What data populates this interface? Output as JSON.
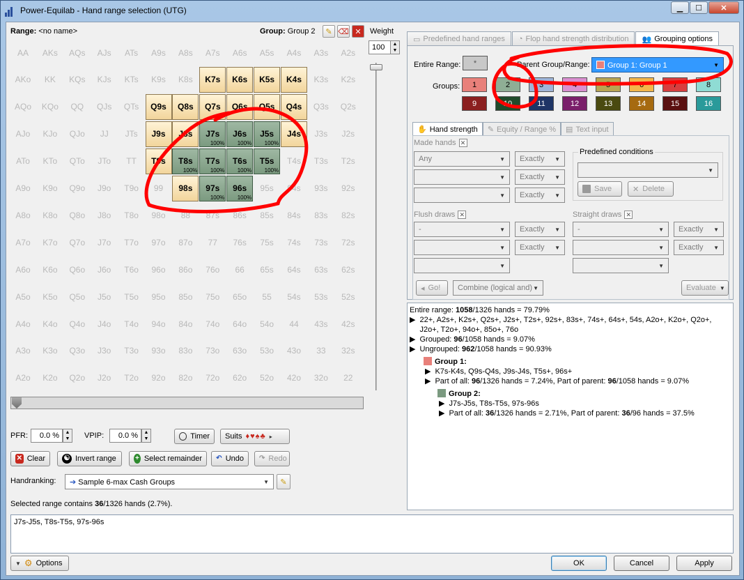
{
  "window": {
    "title": "Power-Equilab - Hand range selection (UTG)"
  },
  "header": {
    "range_label": "Range:",
    "range_value": "<no name>",
    "group_label": "Group:",
    "group_value": "Group 2",
    "weight_label": "Weight",
    "weight_value": "100"
  },
  "grid": {
    "ranks": [
      "A",
      "K",
      "Q",
      "J",
      "T",
      "9",
      "8",
      "7",
      "6",
      "5",
      "4",
      "3",
      "2"
    ],
    "group1": [
      "K7s",
      "K6s",
      "K5s",
      "K4s",
      "Q9s",
      "Q8s",
      "Q7s",
      "Q6s",
      "Q5s",
      "Q4s",
      "J9s",
      "J8s",
      "J4s",
      "T9s",
      "98s"
    ],
    "group2": [
      "J7s",
      "J6s",
      "J5s",
      "T8s",
      "T7s",
      "T6s",
      "T5s",
      "97s",
      "96s"
    ],
    "group2_label": "100%"
  },
  "controls": {
    "pfr_label": "PFR:",
    "pfr_value": "0.0 %",
    "vpip_label": "VPIP:",
    "vpip_value": "0.0 %",
    "timer_label": "Timer",
    "suits_label": "Suits",
    "suits_glyphs": "♦♥♠♣",
    "clear_label": "Clear",
    "invert_label": "Invert range",
    "select_remainder_label": "Select remainder",
    "undo_label": "Undo",
    "redo_label": "Redo",
    "handranking_label": "Handranking:",
    "handranking_value": "Sample 6-max Cash Groups",
    "selected_text_pre": "Selected range contains ",
    "selected_count": "36",
    "selected_text_post": "/1326 hands (2.7%).",
    "range_text": "J7s-J5s, T8s-T5s, 97s-96s"
  },
  "right": {
    "tabs": [
      "Predefined hand ranges",
      "Flop hand strength distribution",
      "Grouping options"
    ],
    "entire_range_label": "Entire Range:",
    "entire_range_btn": "*",
    "parent_label": "Parent Group/Range:",
    "parent_value": "Group 1: Group 1",
    "groups_label": "Groups:",
    "groups": [
      {
        "n": "1",
        "c": "#e8807a"
      },
      {
        "n": "2",
        "c": "#8fae95"
      },
      {
        "n": "3",
        "c": "#9fb4d8"
      },
      {
        "n": "4",
        "c": "#d98fd0"
      },
      {
        "n": "5",
        "c": "#b8a552"
      },
      {
        "n": "6",
        "c": "#f3b64a"
      },
      {
        "n": "7",
        "c": "#d93d3d"
      },
      {
        "n": "8",
        "c": "#8fdcd4"
      },
      {
        "n": "9",
        "c": "#8b1f1f"
      },
      {
        "n": "10",
        "c": "#1f4a2a"
      },
      {
        "n": "11",
        "c": "#1f3566"
      },
      {
        "n": "12",
        "c": "#7a1f6a"
      },
      {
        "n": "13",
        "c": "#4a4a10"
      },
      {
        "n": "14",
        "c": "#a66a10"
      },
      {
        "n": "15",
        "c": "#5a1010"
      },
      {
        "n": "16",
        "c": "#2a9a9a"
      }
    ],
    "inner_tabs": [
      "Hand strength",
      "Equity / Range %",
      "Text input"
    ],
    "made_hands": "Made hands",
    "any": "Any",
    "dash": "-",
    "exactly": "Exactly",
    "predefined_conditions": "Predefined conditions",
    "save": "Save",
    "delete": "Delete",
    "flush_draws": "Flush draws",
    "straight_draws": "Straight draws",
    "go": "Go!",
    "combine": "Combine (logical and)",
    "evaluate": "Evaluate"
  },
  "info": {
    "entire_pre": "Entire range: ",
    "entire_count": "1058",
    "entire_post": "/1326 hands = 79.79%",
    "entire_list": "22+, A2s+, K2s+, Q2s+, J2s+, T2s+, 92s+, 83s+, 74s+, 64s+, 54s, A2o+, K2o+, Q2o+, J2o+, T2o+, 94o+, 85o+, 76o",
    "grouped_pre": "Grouped: ",
    "grouped_count": "96",
    "grouped_post": "/1058 hands = 9.07%",
    "ungrouped_pre": "Ungrouped: ",
    "ungrouped_count": "962",
    "ungrouped_post": "/1058 hands = 90.93%",
    "g1_title": "Group 1:",
    "g1_hands": "K7s-K4s, Q9s-Q4s, J9s-J4s, T5s+, 96s+",
    "g1_part_pre": "Part of all: ",
    "g1_part_count": "96",
    "g1_part_mid": "/1326 hands = 7.24%, Part of parent: ",
    "g1_parent_count": "96",
    "g1_part_post": "/1058 hands = 9.07%",
    "g2_title": "Group 2:",
    "g2_hands": "J7s-J5s, T8s-T5s, 97s-96s",
    "g2_part_pre": "Part of all: ",
    "g2_part_count": "36",
    "g2_part_mid": "/1326 hands = 2.71%, Part of parent: ",
    "g2_parent_count": "36",
    "g2_part_post": "/96 hands = 37.5%"
  },
  "footer": {
    "options": "Options",
    "ok": "OK",
    "cancel": "Cancel",
    "apply": "Apply"
  },
  "colors": {
    "group1": "#f2d59c",
    "group2": "#7b9a80",
    "annotation": "#ff0000",
    "parent_select": "#3399ff"
  }
}
